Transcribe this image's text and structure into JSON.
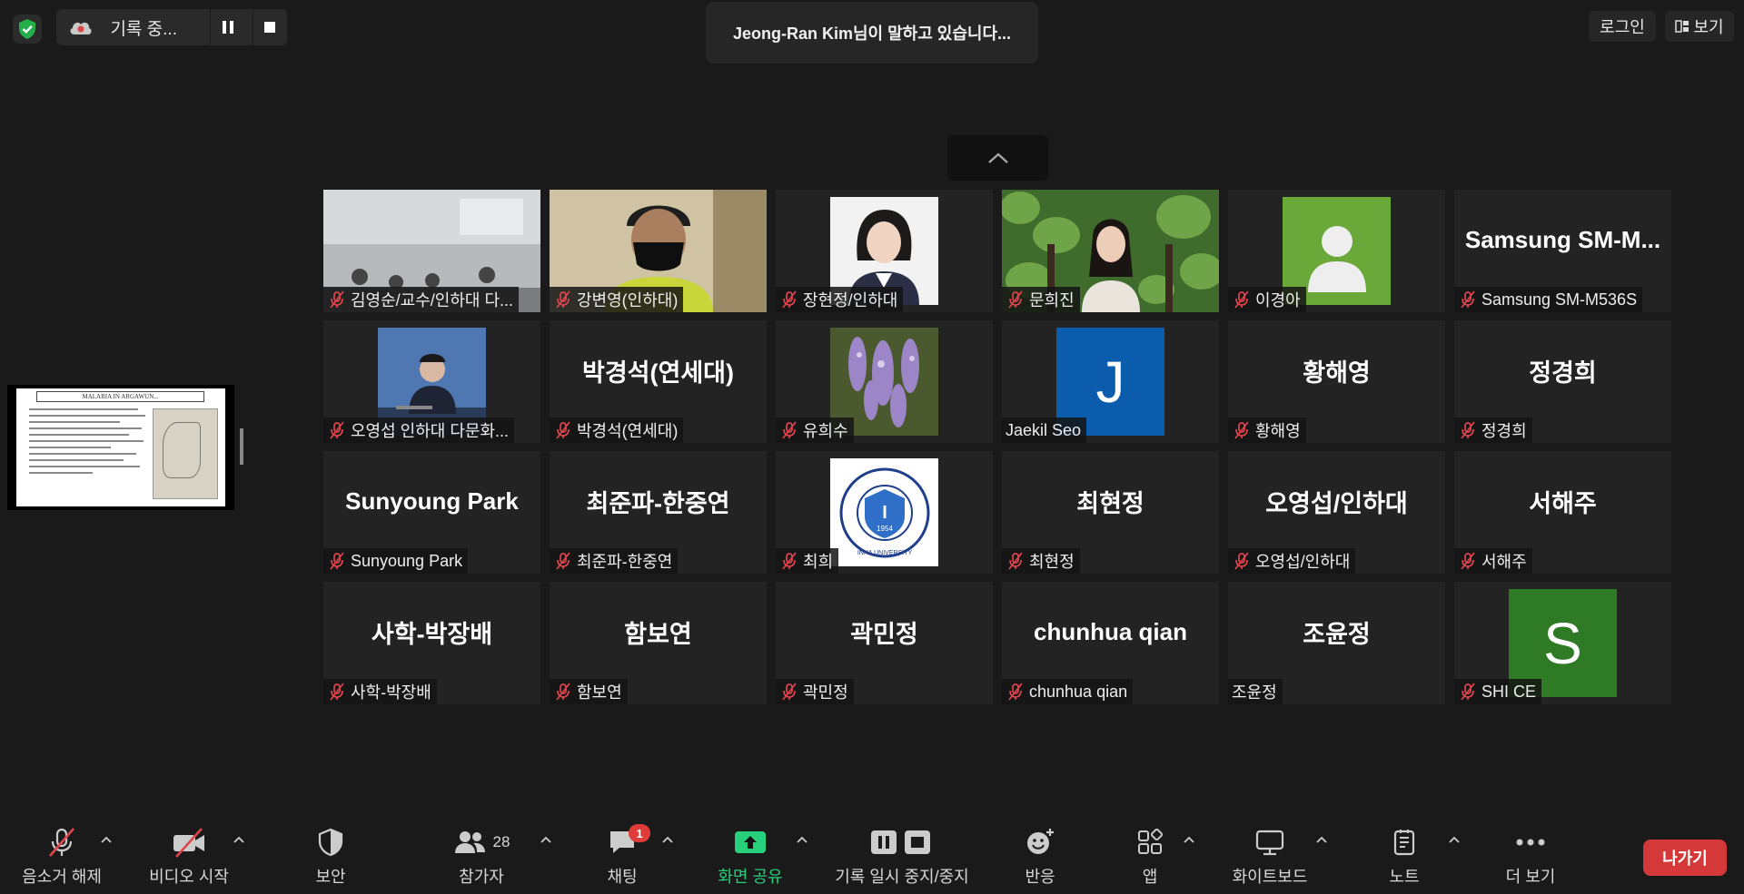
{
  "recording": {
    "label": "기록 중..."
  },
  "speaker_toast": "Jeong-Ran Kim님이 말하고 있습니다...",
  "top_right": {
    "login": "로그인",
    "view": "보기"
  },
  "shared_screen": {
    "title": "MALARIA IN ARGAWUN..."
  },
  "participants": [
    {
      "label": "김영순/교수/인하대 다...",
      "display": "",
      "muted": true,
      "kind": "video-room"
    },
    {
      "label": "강변영(인하대)",
      "display": "",
      "muted": true,
      "kind": "video-person-mask"
    },
    {
      "label": "장현정/인하대",
      "display": "",
      "muted": true,
      "kind": "photo-portrait"
    },
    {
      "label": "문희진",
      "display": "",
      "muted": true,
      "kind": "photo-leaves"
    },
    {
      "label": "이경아",
      "display": "",
      "muted": true,
      "kind": "avatar-person",
      "color": "#6aa83a"
    },
    {
      "label": "Samsung SM-M536S",
      "display": "Samsung  SM-M...",
      "muted": true,
      "kind": "name"
    },
    {
      "label": "오영섭 인하대 다문화...",
      "display": "",
      "muted": true,
      "kind": "photo-speaker"
    },
    {
      "label": "박경석(연세대)",
      "display": "박경석(연세대)",
      "muted": true,
      "kind": "name"
    },
    {
      "label": "유희수",
      "display": "",
      "muted": true,
      "kind": "photo-wisteria"
    },
    {
      "label": "Jaekil Seo",
      "display": "",
      "muted": false,
      "kind": "avatar-letter",
      "letter": "J",
      "color": "#0b5cad"
    },
    {
      "label": "황해영",
      "display": "황해영",
      "muted": true,
      "kind": "name"
    },
    {
      "label": "정경희",
      "display": "정경희",
      "muted": true,
      "kind": "name"
    },
    {
      "label": "Sunyoung Park",
      "display": "Sunyoung Park",
      "muted": true,
      "kind": "name"
    },
    {
      "label": "최준파-한중연",
      "display": "최준파-한중연",
      "muted": true,
      "kind": "name"
    },
    {
      "label": "최희",
      "display": "",
      "muted": true,
      "kind": "logo-university",
      "logo_text": "INHA UNIVERSITY",
      "logo_year": "1954"
    },
    {
      "label": "최현정",
      "display": "최현정",
      "muted": true,
      "kind": "name"
    },
    {
      "label": "오영섭/인하대",
      "display": "오영섭/인하대",
      "muted": true,
      "kind": "name"
    },
    {
      "label": "서해주",
      "display": "서해주",
      "muted": true,
      "kind": "name"
    },
    {
      "label": "사학-박장배",
      "display": "사학-박장배",
      "muted": true,
      "kind": "name"
    },
    {
      "label": "함보연",
      "display": "함보연",
      "muted": true,
      "kind": "name"
    },
    {
      "label": "곽민정",
      "display": "곽민정",
      "muted": true,
      "kind": "name"
    },
    {
      "label": "chunhua qian",
      "display": "chunhua qian",
      "muted": true,
      "kind": "name"
    },
    {
      "label": "조윤정",
      "display": "조윤정",
      "muted": false,
      "kind": "name"
    },
    {
      "label": "SHI CE",
      "display": "",
      "muted": true,
      "kind": "avatar-letter",
      "letter": "S",
      "color": "#2f7a25"
    }
  ],
  "toolbar": {
    "unmute": "음소거 해제",
    "start_video": "비디오 시작",
    "security": "보안",
    "participants": "참가자",
    "participants_count": "28",
    "chat": "채팅",
    "chat_badge": "1",
    "share": "화면 공유",
    "record": "기록 일시 중지/중지",
    "reactions": "반응",
    "apps": "앱",
    "whiteboard": "화이트보드",
    "notes": "노트",
    "more": "더 보기",
    "leave": "나가기"
  },
  "colors": {
    "accent_green": "#27d07a",
    "leave_red": "#d53838",
    "badge_red": "#e03b3b",
    "mute_red": "#e0454d"
  }
}
